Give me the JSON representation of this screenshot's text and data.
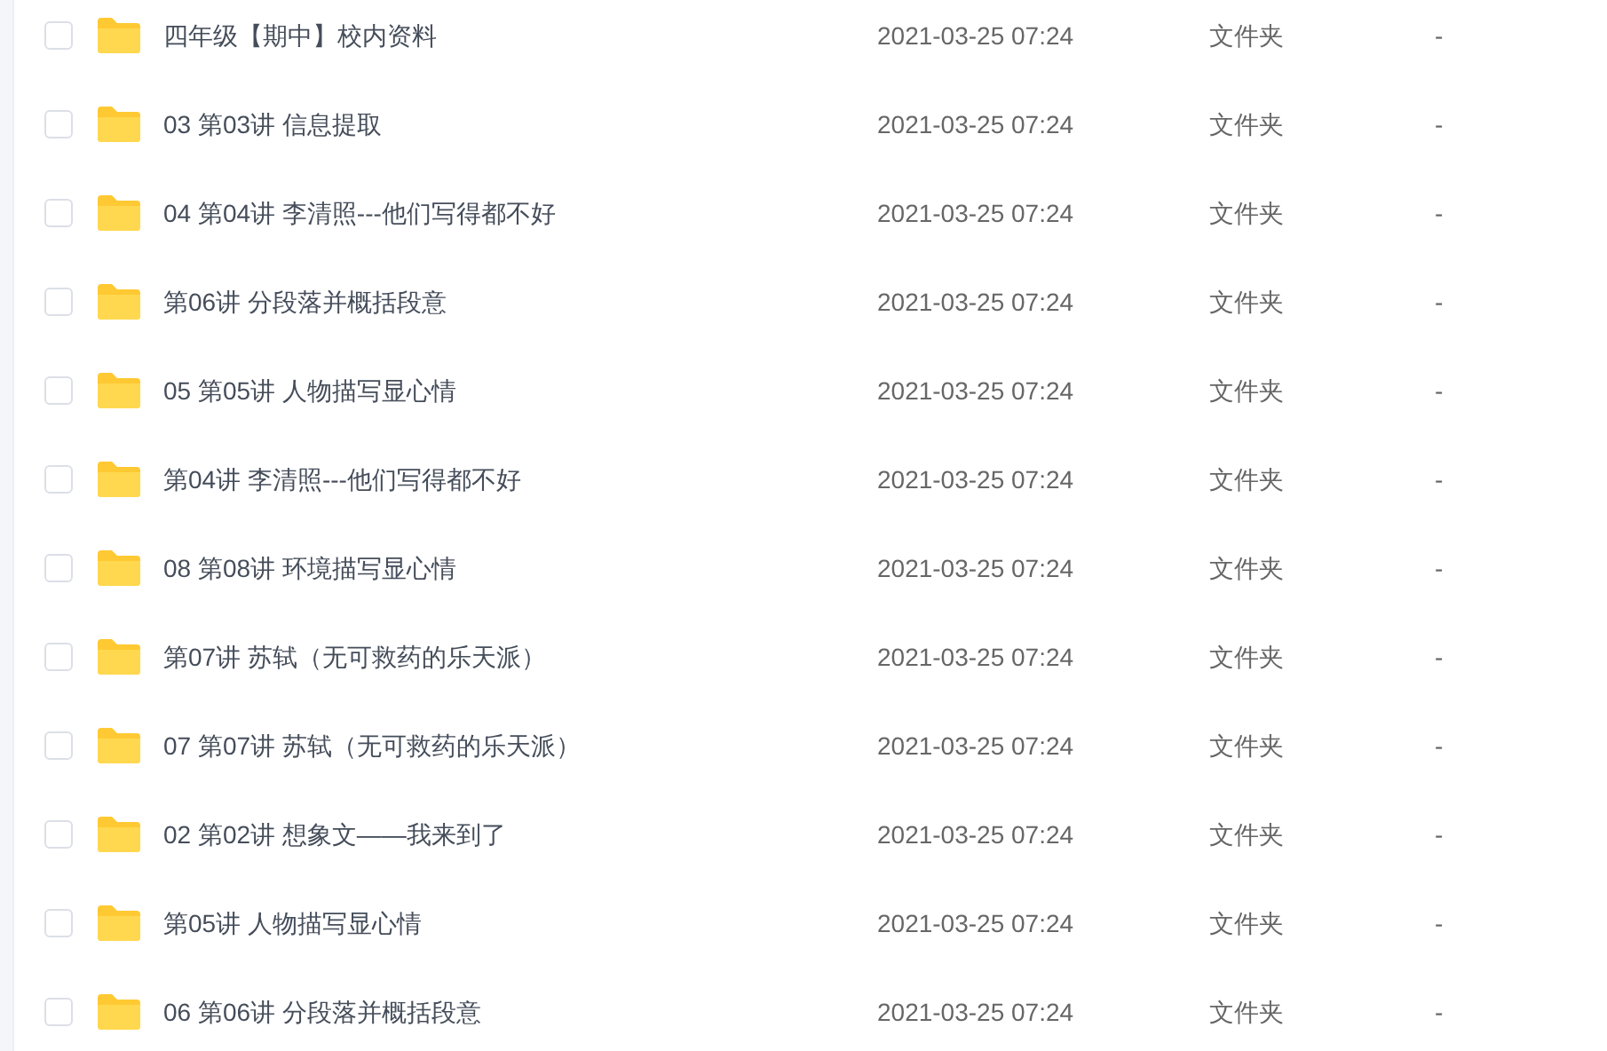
{
  "files": [
    {
      "name": "四年级【期中】校内资料",
      "checked": false,
      "modified": "2021-03-25 07:24",
      "type": "文件夹",
      "size": "-"
    },
    {
      "name": "03 第03讲 信息提取",
      "checked": false,
      "modified": "2021-03-25 07:24",
      "type": "文件夹",
      "size": "-"
    },
    {
      "name": "04 第04讲 李清照---他们写得都不好",
      "checked": false,
      "modified": "2021-03-25 07:24",
      "type": "文件夹",
      "size": "-"
    },
    {
      "name": "第06讲 分段落并概括段意",
      "checked": false,
      "modified": "2021-03-25 07:24",
      "type": "文件夹",
      "size": "-"
    },
    {
      "name": "05 第05讲 人物描写显心情",
      "checked": false,
      "modified": "2021-03-25 07:24",
      "type": "文件夹",
      "size": "-"
    },
    {
      "name": "第04讲 李清照---他们写得都不好",
      "checked": false,
      "modified": "2021-03-25 07:24",
      "type": "文件夹",
      "size": "-"
    },
    {
      "name": "08 第08讲 环境描写显心情",
      "checked": false,
      "modified": "2021-03-25 07:24",
      "type": "文件夹",
      "size": "-"
    },
    {
      "name": "第07讲 苏轼（无可救药的乐天派）",
      "checked": false,
      "modified": "2021-03-25 07:24",
      "type": "文件夹",
      "size": "-"
    },
    {
      "name": "07 第07讲 苏轼（无可救药的乐天派）",
      "checked": false,
      "modified": "2021-03-25 07:24",
      "type": "文件夹",
      "size": "-"
    },
    {
      "name": "02 第02讲 想象文——我来到了",
      "checked": false,
      "modified": "2021-03-25 07:24",
      "type": "文件夹",
      "size": "-"
    },
    {
      "name": "第05讲 人物描写显心情",
      "checked": false,
      "modified": "2021-03-25 07:24",
      "type": "文件夹",
      "size": "-"
    },
    {
      "name": "06 第06讲 分段落并概括段意",
      "checked": false,
      "modified": "2021-03-25 07:24",
      "type": "文件夹",
      "size": "-"
    }
  ]
}
